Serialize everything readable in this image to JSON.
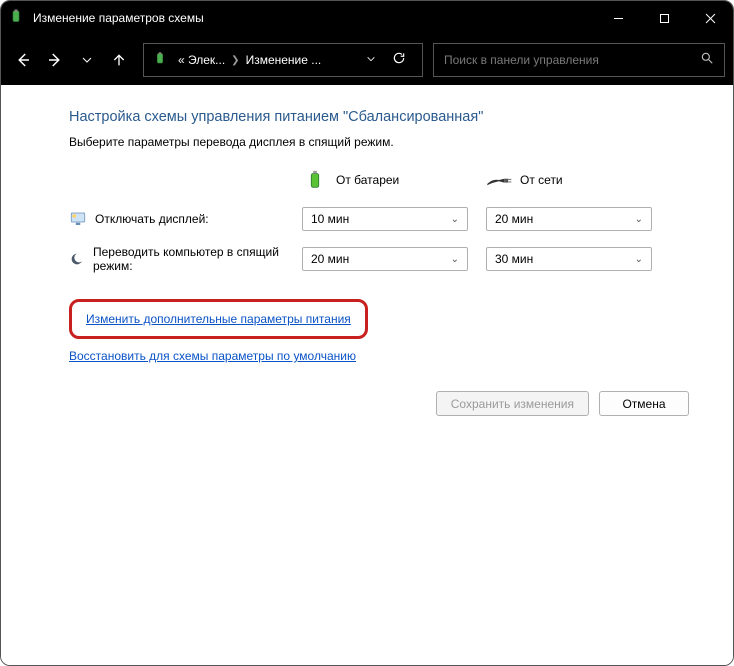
{
  "window": {
    "title": "Изменение параметров схемы"
  },
  "breadcrumb": {
    "item1": "« Элек...",
    "item2": "Изменение ..."
  },
  "search": {
    "placeholder": "Поиск в панели управления"
  },
  "page": {
    "heading": "Настройка схемы управления питанием \"Сбалансированная\"",
    "subtext": "Выберите параметры перевода дисплея в спящий режим."
  },
  "columns": {
    "battery": "От батареи",
    "mains": "От сети"
  },
  "rows": {
    "display_off": "Отключать дисплей:",
    "sleep": "Переводить компьютер в спящий режим:"
  },
  "values": {
    "display_battery": "10 мин",
    "display_mains": "20 мин",
    "sleep_battery": "20 мин",
    "sleep_mains": "30 мин"
  },
  "links": {
    "advanced": "Изменить дополнительные параметры питания",
    "restore": "Восстановить для схемы параметры по умолчанию"
  },
  "buttons": {
    "save": "Сохранить изменения",
    "cancel": "Отмена"
  }
}
